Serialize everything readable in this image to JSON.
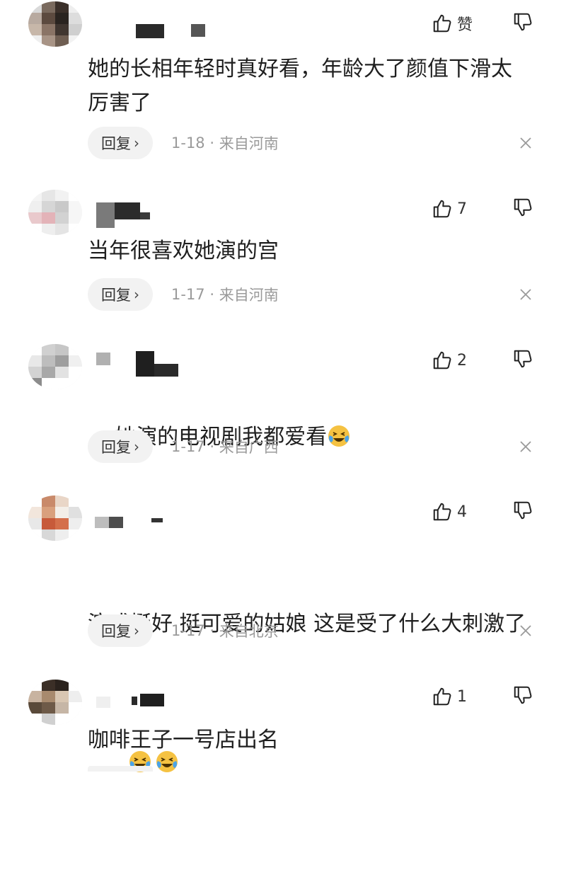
{
  "comments": [
    {
      "like_label": "赞",
      "text": "她的长相年轻时真好看，年龄大了颜值下滑太\n厉害了",
      "reply_label": "回复",
      "date": "1-18",
      "separator": "·",
      "location": "来自河南"
    },
    {
      "like_label": "7",
      "text": "当年很喜欢她演的宫",
      "reply_label": "回复",
      "date": "1-17",
      "separator": "·",
      "location": "来自河南"
    },
    {
      "like_label": "2",
      "text": "她演的电视剧我都爱看",
      "reply_label": "回复",
      "date": "1-17",
      "separator": "·",
      "location": "来自广西"
    },
    {
      "like_label": "4",
      "text": "演戏挺好 挺可爱的姑娘 这是受了什么大刺激了",
      "reply_label": "回复",
      "date": "1-17",
      "separator": "·",
      "location": "来自北京"
    },
    {
      "like_label": "1",
      "text": "咖啡王子一号店出名"
    }
  ],
  "icons": {
    "like": "thumbs-up-outline",
    "dislike": "thumbs-down-outline",
    "emoji": "crying-laughing-face",
    "close": "close-x",
    "reply_chevron": "chevron-right"
  },
  "colors": {
    "text": "#1f1f1f",
    "meta": "#9a9a9a",
    "reply_bg": "#f2f2f2",
    "emoji_face": "#f5c242",
    "emoji_tears": "#4aa3e8"
  },
  "reply_chevron_glyph": "›"
}
